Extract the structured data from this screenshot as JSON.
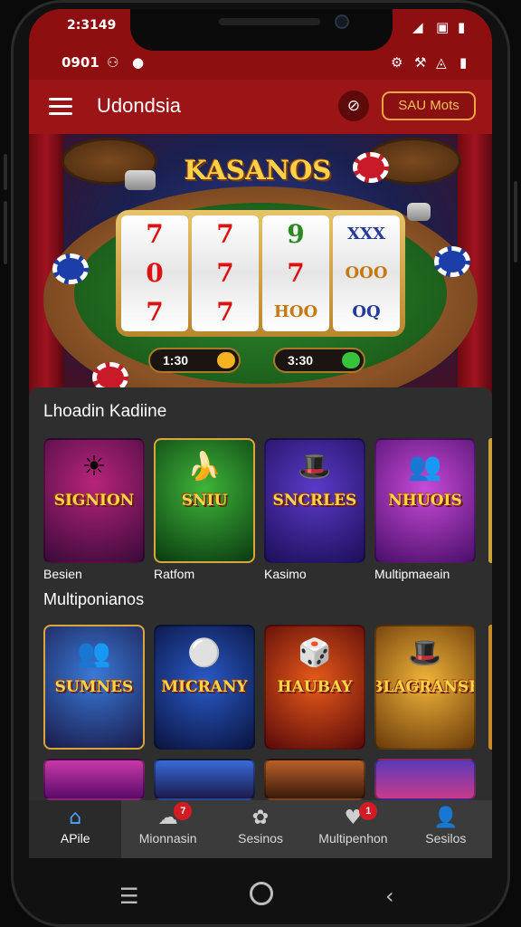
{
  "status_bar": {
    "time_top": "2:3149",
    "time_second": "0901",
    "left_icons": [
      "signal-bars-icon",
      "location-icon"
    ],
    "right_icons_top": [
      "signal-icon",
      "sim-icon",
      "battery-icon"
    ],
    "right_icons_second": [
      "settings-icon",
      "network-icon",
      "wifi-icon",
      "battery-icon"
    ]
  },
  "app_bar": {
    "title": "Udondsia",
    "action_icon": "ban-icon",
    "pill_button": "SAU Mots"
  },
  "hero": {
    "logo": "KASANOS",
    "reels": [
      [
        "7",
        "0",
        "7"
      ],
      [
        "7",
        "7",
        "7"
      ],
      [
        "9",
        "7",
        "HOO"
      ],
      [
        "XXX",
        "OOO",
        "OQ"
      ]
    ],
    "balance_left": "1:30",
    "balance_right": "3:30"
  },
  "sections": [
    {
      "title": "Lhoadin Kadiine",
      "cards": [
        {
          "label": "Besien",
          "art": "SIGNION",
          "glyph": "☀"
        },
        {
          "label": "Ratfom",
          "art": "SNIU",
          "glyph": "🍌"
        },
        {
          "label": "Kasimo",
          "art": "SNCRLES",
          "glyph": "🎩"
        },
        {
          "label": "Multipmaeain",
          "art": "NHUOIS",
          "glyph": "👥"
        }
      ]
    },
    {
      "title": "Multiponianos",
      "cards": [
        {
          "label": "",
          "art": "SUMNES",
          "glyph": "👥"
        },
        {
          "label": "",
          "art": "MICRANY",
          "glyph": "⚪"
        },
        {
          "label": "",
          "art": "HAUBAY",
          "glyph": "🎲"
        },
        {
          "label": "",
          "art": "BLAGRANSE",
          "glyph": "🎩"
        }
      ]
    }
  ],
  "bottom_nav": [
    {
      "label": "APile",
      "icon": "home-icon",
      "active": true,
      "badge": ""
    },
    {
      "label": "Mionnasin",
      "icon": "chat-icon",
      "active": false,
      "badge": "7"
    },
    {
      "label": "Sesinos",
      "icon": "puzzle-icon",
      "active": false,
      "badge": ""
    },
    {
      "label": "Multipenhon",
      "icon": "heart-icon",
      "active": false,
      "badge": "1"
    },
    {
      "label": "Sesilos",
      "icon": "user-icon",
      "active": false,
      "badge": ""
    }
  ],
  "system_nav": [
    "recents-icon",
    "home-circle-icon",
    "back-icon"
  ],
  "colors": {
    "status_bar": "#8e0f10",
    "app_bar": "#9b1416",
    "accent": "#f0a640",
    "active_nav": "#4aa3ff",
    "badge": "#d21b22"
  }
}
